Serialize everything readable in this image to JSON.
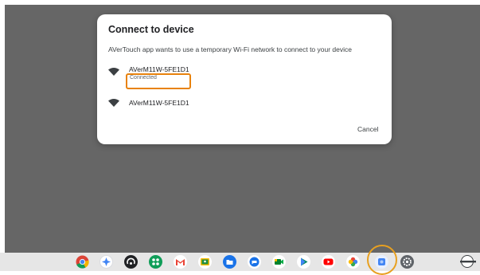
{
  "dialog": {
    "title": "Connect to device",
    "message": "AVerTouch app wants to use a temporary Wi-Fi network to connect to your device",
    "networks": [
      {
        "name": "AVerM11W-5FE1D1",
        "status": "Connected"
      },
      {
        "name": "AVerM11W-5FE1D1",
        "status": ""
      }
    ],
    "cancel_label": "Cancel"
  },
  "shelf": {
    "apps": [
      {
        "name": "chrome-icon"
      },
      {
        "name": "assistant-icon"
      },
      {
        "name": "avertouch-icon"
      },
      {
        "name": "launcher-grid-icon"
      },
      {
        "name": "gmail-icon"
      },
      {
        "name": "classroom-icon"
      },
      {
        "name": "files-icon"
      },
      {
        "name": "messages-icon"
      },
      {
        "name": "meet-icon"
      },
      {
        "name": "play-store-icon"
      },
      {
        "name": "youtube-icon"
      },
      {
        "name": "photos-icon"
      },
      {
        "name": "camera-app-icon"
      },
      {
        "name": "settings-icon"
      }
    ]
  },
  "colors": {
    "highlight": "#e8820c",
    "desktop": "#666666"
  }
}
